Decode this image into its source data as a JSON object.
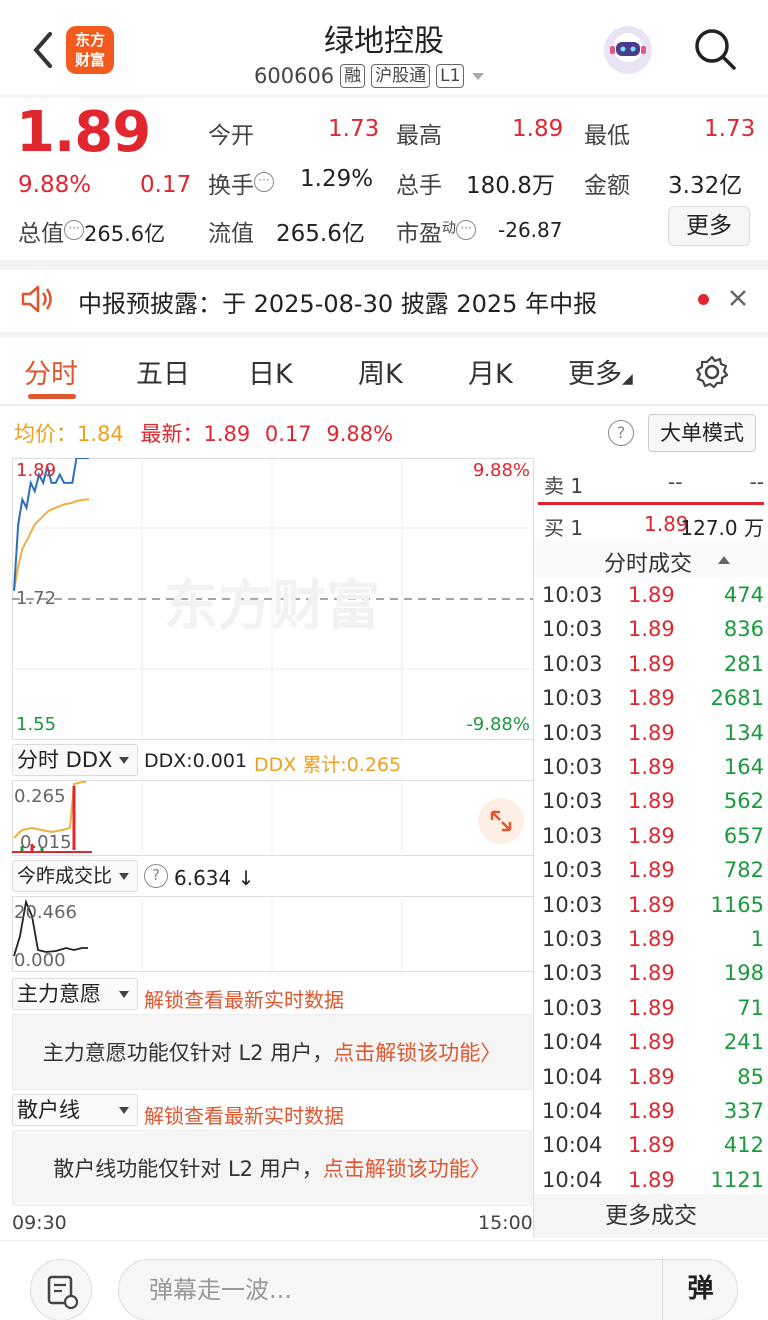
{
  "header": {
    "logo_text": "东方财富",
    "title": "绿地控股",
    "code": "600606",
    "tags": [
      "融",
      "沪股通",
      "L1"
    ]
  },
  "quote": {
    "price": "1.89",
    "change_pct": "9.88%",
    "change": "0.17",
    "total_value_label": "总值",
    "total_value": "265.6亿",
    "open_label": "今开",
    "open": "1.73",
    "high_label": "最高",
    "high": "1.89",
    "low_label": "最低",
    "low": "1.73",
    "turnover_label": "换手",
    "turnover": "1.29%",
    "volume_label": "总手",
    "volume": "180.8万",
    "amount_label": "金额",
    "amount": "3.32亿",
    "float_label": "流值",
    "float_value": "265.6亿",
    "pe_label": "市盈",
    "pe_sup": "动",
    "pe": "-26.87",
    "more_label": "更多"
  },
  "notice": {
    "text": "中报预披露：于 2025-08-30 披露 2025 年中报"
  },
  "tabs": [
    "分时",
    "五日",
    "日K",
    "周K",
    "月K",
    "更多"
  ],
  "chart": {
    "avg_label": "均价：",
    "avg": "1.84",
    "latest_label": "最新：",
    "latest": "1.89",
    "latest_change": "0.17",
    "latest_pct": "9.88%",
    "big_order_label": "大单模式",
    "y_top": "1.89",
    "y_mid": "1.72",
    "y_bottom": "1.55",
    "pct_top": "9.88%",
    "pct_bottom": "-9.88%",
    "watermark": "东方财富",
    "time_start": "09:30",
    "time_end": "15:00"
  },
  "chart_data": {
    "type": "line",
    "ylim": [
      1.55,
      1.89
    ],
    "reference": 1.72,
    "series": [
      {
        "name": "最新",
        "color": "#2f6fb8",
        "values": [
          1.73,
          1.81,
          1.84,
          1.83,
          1.86,
          1.85,
          1.87,
          1.86,
          1.88,
          1.86,
          1.86,
          1.87,
          1.86,
          1.86,
          1.86,
          1.89,
          1.89,
          1.89,
          1.89
        ]
      },
      {
        "name": "均价",
        "color": "#f0b040",
        "values": [
          1.73,
          1.76,
          1.78,
          1.79,
          1.8,
          1.81,
          1.815,
          1.82,
          1.825,
          1.828,
          1.83,
          1.832,
          1.834,
          1.835,
          1.836,
          1.838,
          1.839,
          1.84,
          1.84
        ]
      }
    ]
  },
  "ddx": {
    "dropdown": "分时 DDX",
    "value_text": "DDX:0.001",
    "cum_text": "DDX 累计:0.265",
    "y_top": "0.265",
    "y_bottom": "0.015"
  },
  "vol_ratio": {
    "dropdown": "今昨成交比",
    "value_text": "6.634 ↓",
    "y_top": "20.466",
    "y_bottom": "0.000"
  },
  "main_force": {
    "dropdown": "主力意愿",
    "unlock": "解锁查看最新实时数据",
    "box_text": "主力意愿功能仅针对 L2 用户，",
    "box_link": "点击解锁该功能〉"
  },
  "retail": {
    "dropdown": "散户线",
    "unlock": "解锁查看最新实时数据",
    "box_text": "散户线功能仅针对 L2 用户，",
    "box_link": "点击解锁该功能〉"
  },
  "orderbook": {
    "sell_label": "卖 1",
    "sell_price": "--",
    "sell_vol": "--",
    "buy_label": "买 1",
    "buy_price": "1.89",
    "buy_vol": "127.0 万"
  },
  "trades": {
    "title": "分时成交",
    "rows": [
      {
        "time": "10:03",
        "price": "1.89",
        "vol": "474"
      },
      {
        "time": "10:03",
        "price": "1.89",
        "vol": "836"
      },
      {
        "time": "10:03",
        "price": "1.89",
        "vol": "281"
      },
      {
        "time": "10:03",
        "price": "1.89",
        "vol": "2681"
      },
      {
        "time": "10:03",
        "price": "1.89",
        "vol": "134"
      },
      {
        "time": "10:03",
        "price": "1.89",
        "vol": "164"
      },
      {
        "time": "10:03",
        "price": "1.89",
        "vol": "562"
      },
      {
        "time": "10:03",
        "price": "1.89",
        "vol": "657"
      },
      {
        "time": "10:03",
        "price": "1.89",
        "vol": "782"
      },
      {
        "time": "10:03",
        "price": "1.89",
        "vol": "1165"
      },
      {
        "time": "10:03",
        "price": "1.89",
        "vol": "1"
      },
      {
        "time": "10:03",
        "price": "1.89",
        "vol": "198"
      },
      {
        "time": "10:03",
        "price": "1.89",
        "vol": "71"
      },
      {
        "time": "10:04",
        "price": "1.89",
        "vol": "241"
      },
      {
        "time": "10:04",
        "price": "1.89",
        "vol": "85"
      },
      {
        "time": "10:04",
        "price": "1.89",
        "vol": "337"
      },
      {
        "time": "10:04",
        "price": "1.89",
        "vol": "412"
      },
      {
        "time": "10:04",
        "price": "1.89",
        "vol": "1121"
      }
    ],
    "more_label": "更多成交"
  },
  "bottom": {
    "placeholder": "弹幕走一波...",
    "toggle": "弹"
  }
}
